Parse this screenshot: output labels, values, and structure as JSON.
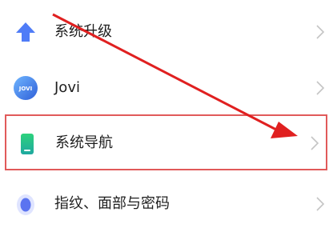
{
  "settings": {
    "items": [
      {
        "label": "系统升级",
        "icon": "upgrade-arrow-icon"
      },
      {
        "label": "Jovi",
        "icon": "jovi-icon",
        "icon_text": "JOVI"
      },
      {
        "label": "系统导航",
        "icon": "navigation-icon"
      },
      {
        "label": "指纹、面部与密码",
        "icon": "fingerprint-icon"
      }
    ]
  },
  "colors": {
    "highlight_border": "#e15a5a",
    "annotation_arrow": "#e02020",
    "chevron": "#c4c4c4",
    "upgrade_icon": "#4f7cf7",
    "jovi_icon": "#3b78e7",
    "navigation_icon": "#2fc07c",
    "fingerprint_icon": "#5b74f0"
  }
}
